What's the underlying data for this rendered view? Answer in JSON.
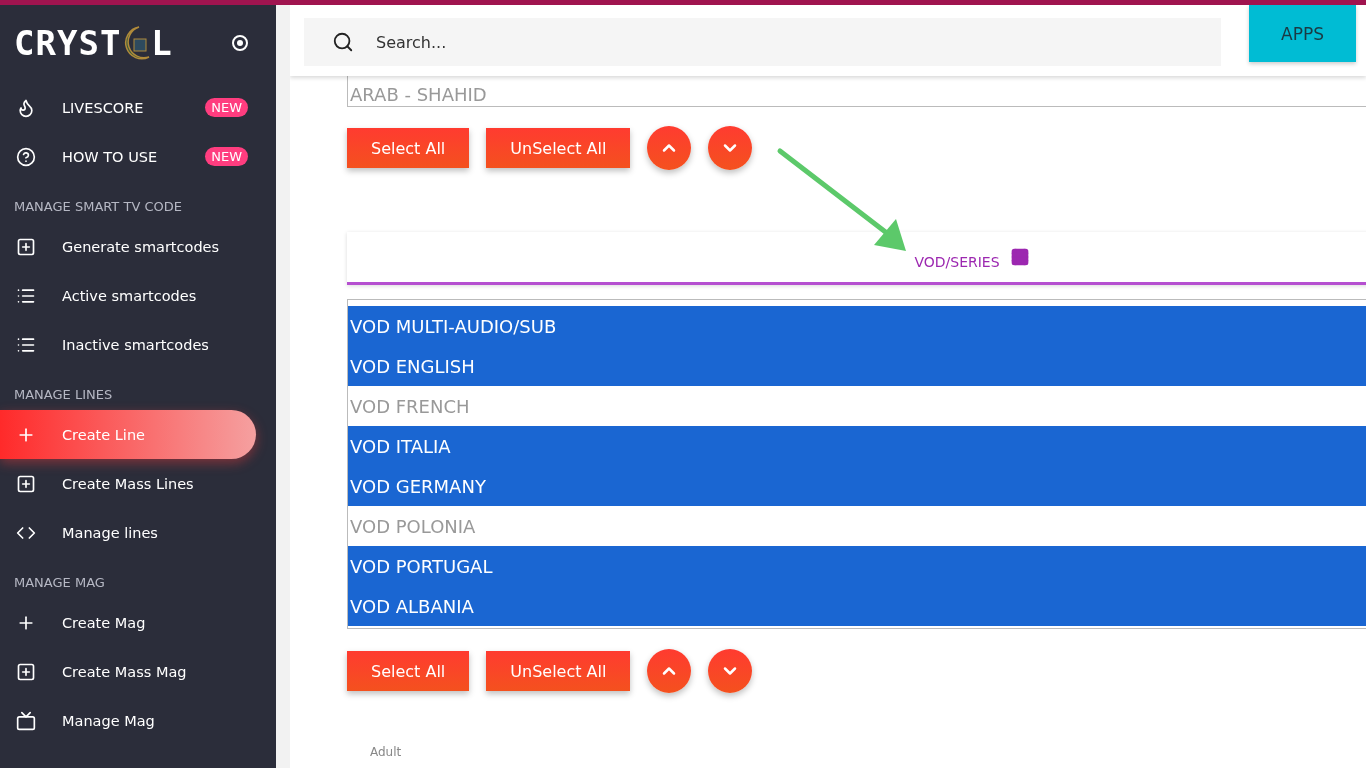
{
  "logo": {
    "before": "CRYST",
    "after": "L"
  },
  "sidebar": {
    "items": [
      {
        "kind": "link",
        "label": "LIVESCORE",
        "badge": "NEW",
        "selected": false
      },
      {
        "kind": "link",
        "label": "HOW TO USE",
        "badge": "NEW",
        "selected": false
      },
      {
        "kind": "section",
        "label": "MANAGE SMART TV CODE"
      },
      {
        "kind": "link",
        "label": "Generate smartcodes",
        "selected": false
      },
      {
        "kind": "link",
        "label": "Active smartcodes",
        "selected": false
      },
      {
        "kind": "link",
        "label": "Inactive smartcodes",
        "selected": false
      },
      {
        "kind": "section",
        "label": "MANAGE LINES"
      },
      {
        "kind": "link",
        "label": "Create Line",
        "selected": true
      },
      {
        "kind": "link",
        "label": "Create Mass Lines",
        "selected": false
      },
      {
        "kind": "link",
        "label": "Manage lines",
        "selected": false
      },
      {
        "kind": "section",
        "label": "MANAGE MAG"
      },
      {
        "kind": "link",
        "label": "Create Mag",
        "selected": false
      },
      {
        "kind": "link",
        "label": "Create Mass Mag",
        "selected": false
      },
      {
        "kind": "link",
        "label": "Manage Mag",
        "selected": false
      }
    ]
  },
  "search": {
    "placeholder": "Search..."
  },
  "apps_button": "APPS",
  "top_list": {
    "items": [
      {
        "label": "ARAB - SHAHID",
        "selected": false
      }
    ],
    "buttons": {
      "select_all": "Select All",
      "unselect_all": "UnSelect All"
    }
  },
  "vod_section": {
    "title": "VOD/SERIES",
    "items": [
      {
        "label": "VOD MULTI-AUDIO/SUB",
        "selected": true
      },
      {
        "label": "VOD ENGLISH",
        "selected": true
      },
      {
        "label": "VOD FRENCH",
        "selected": false
      },
      {
        "label": "VOD ITALIA",
        "selected": true
      },
      {
        "label": "VOD GERMANY",
        "selected": true
      },
      {
        "label": "VOD POLONIA",
        "selected": false
      },
      {
        "label": "VOD PORTUGAL",
        "selected": true
      },
      {
        "label": "VOD ALBANIA",
        "selected": true
      }
    ],
    "buttons": {
      "select_all": "Select All",
      "unselect_all": "UnSelect All"
    }
  },
  "next_section": {
    "title": "Adult"
  }
}
